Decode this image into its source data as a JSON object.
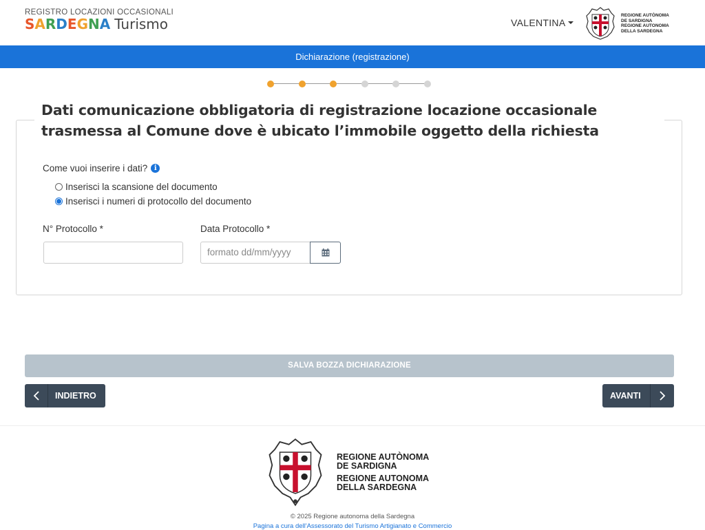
{
  "header": {
    "brand_small": "REGISTRO LOCAZIONI OCCASIONALI",
    "brand_letters": [
      {
        "ch": "S",
        "color": "#e8562a"
      },
      {
        "ch": "A",
        "color": "#f0a22e"
      },
      {
        "ch": "R",
        "color": "#3f9f52"
      },
      {
        "ch": "D",
        "color": "#2a7fc8"
      },
      {
        "ch": "E",
        "color": "#e8562a"
      },
      {
        "ch": "G",
        "color": "#f0a22e"
      },
      {
        "ch": "N",
        "color": "#3f9f52"
      },
      {
        "ch": "A",
        "color": "#2a7fc8"
      }
    ],
    "brand_word": "SARDEGNA",
    "brand_suffix": "Turismo",
    "user_name": "VALENTINA",
    "region_logo_lines": [
      "REGIONE AUTÒNOMA",
      "DE SARDIGNA",
      "REGIONE AUTONOMA",
      "DELLA SARDEGNA"
    ]
  },
  "blue_bar": {
    "title": "Dichiarazione (registrazione)"
  },
  "stepper": {
    "total_steps": 6,
    "completed_steps": 3
  },
  "form": {
    "legend": "Dati comunicazione obbligatoria di registrazione locazione occasionale trasmessa al Comune dove è ubicato l’immobile oggetto della richiesta",
    "question": "Come vuoi inserire i dati?",
    "options": [
      {
        "label": "Inserisci la scansione del documento",
        "checked": false
      },
      {
        "label": "Inserisci i numeri di protocollo del documento",
        "checked": true
      }
    ],
    "protocol_number_label": "N° Protocollo *",
    "protocol_number_value": "",
    "protocol_date_label": "Data Protocollo *",
    "protocol_date_placeholder": "formato dd/mm/yyyy"
  },
  "actions": {
    "save_draft": "SALVA BOZZA DICHIARAZIONE",
    "back": "INDIETRO",
    "next": "AVANTI"
  },
  "footer": {
    "logo_lines": [
      "REGIONE AUTÒNOMA",
      "DE SARDIGNA",
      "REGIONE AUTONOMA",
      "DELLA SARDEGNA"
    ],
    "copyright": "© 2025 Regione autonoma della Sardegna",
    "credit": "Pagina a cura dell'Assessorato del Turismo Artigianato e Commercio"
  },
  "colors": {
    "primary_blue": "#1a73d9",
    "step_done": "#f0a22e",
    "step_todo": "#d5d5d5",
    "button_dark": "#3c4a59",
    "button_disabled": "#b7c3cc"
  }
}
